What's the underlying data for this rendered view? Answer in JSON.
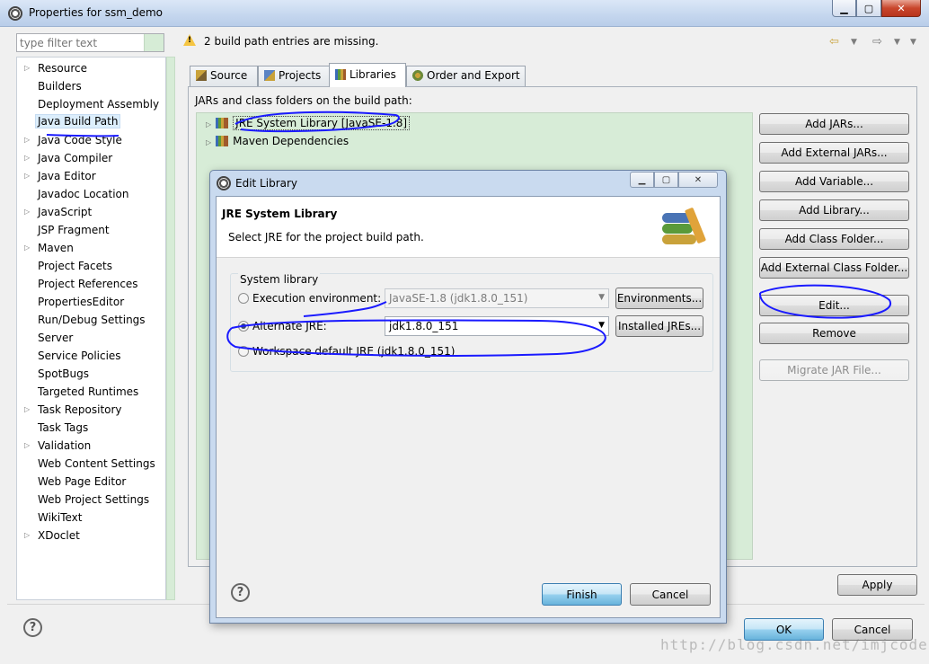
{
  "window": {
    "title": "Properties for ssm_demo",
    "controls": {
      "min": "▁",
      "max": "▢",
      "close": "✕"
    }
  },
  "filter": {
    "placeholder": "type filter text"
  },
  "nav": {
    "items": [
      {
        "label": "Resource",
        "expandable": true
      },
      {
        "label": "Builders",
        "expandable": false
      },
      {
        "label": "Deployment Assembly",
        "expandable": false
      },
      {
        "label": "Java Build Path",
        "expandable": false,
        "selected": true
      },
      {
        "label": "Java Code Style",
        "expandable": true
      },
      {
        "label": "Java Compiler",
        "expandable": true
      },
      {
        "label": "Java Editor",
        "expandable": true
      },
      {
        "label": "Javadoc Location",
        "expandable": false
      },
      {
        "label": "JavaScript",
        "expandable": true
      },
      {
        "label": "JSP Fragment",
        "expandable": false
      },
      {
        "label": "Maven",
        "expandable": true
      },
      {
        "label": "Project Facets",
        "expandable": false
      },
      {
        "label": "Project References",
        "expandable": false
      },
      {
        "label": "PropertiesEditor",
        "expandable": false
      },
      {
        "label": "Run/Debug Settings",
        "expandable": false
      },
      {
        "label": "Server",
        "expandable": false
      },
      {
        "label": "Service Policies",
        "expandable": false
      },
      {
        "label": "SpotBugs",
        "expandable": false
      },
      {
        "label": "Targeted Runtimes",
        "expandable": false
      },
      {
        "label": "Task Repository",
        "expandable": true
      },
      {
        "label": "Task Tags",
        "expandable": false
      },
      {
        "label": "Validation",
        "expandable": true
      },
      {
        "label": "Web Content Settings",
        "expandable": false
      },
      {
        "label": "Web Page Editor",
        "expandable": false
      },
      {
        "label": "Web Project Settings",
        "expandable": false
      },
      {
        "label": "WikiText",
        "expandable": false
      },
      {
        "label": "XDoclet",
        "expandable": true
      }
    ]
  },
  "header": {
    "message": "2 build path entries are missing.",
    "icons": {
      "warning": "warning-icon",
      "back": "back-arrow-icon",
      "forward": "forward-arrow-icon",
      "menu": "view-menu-icon"
    }
  },
  "tabs": [
    {
      "label": "Source",
      "icon": "source-icon"
    },
    {
      "label": "Projects",
      "icon": "projects-icon"
    },
    {
      "label": "Libraries",
      "icon": "libraries-icon",
      "active": true
    },
    {
      "label": "Order and Export",
      "icon": "order-export-icon"
    }
  ],
  "libraries": {
    "label": "JARs and class folders on the build path:",
    "entries": [
      {
        "label": "JRE System Library [JavaSE-1.8]",
        "selected": true
      },
      {
        "label": "Maven Dependencies",
        "selected": false
      }
    ],
    "buttons": {
      "add_jars": "Add JARs...",
      "add_external_jars": "Add External JARs...",
      "add_variable": "Add Variable...",
      "add_library": "Add Library...",
      "add_class_folder": "Add Class Folder...",
      "add_external_class_folder": "Add External Class Folder...",
      "edit": "Edit...",
      "remove": "Remove",
      "migrate_jar": "Migrate JAR File..."
    }
  },
  "footer": {
    "apply": "Apply",
    "ok": "OK",
    "cancel": "Cancel",
    "help": "?"
  },
  "dialog": {
    "title": "Edit Library",
    "controls": {
      "min": "▁",
      "max": "▢",
      "close": "✕"
    },
    "header_title": "JRE System Library",
    "header_desc": "Select JRE for the project build path.",
    "group_title": "System library",
    "exec_env": {
      "label": "Execution environment:",
      "value": "JavaSE-1.8 (jdk1.8.0_151)",
      "button": "Environments...",
      "checked": false
    },
    "alt_jre": {
      "label": "Alternate JRE:",
      "value": "jdk1.8.0_151",
      "button": "Installed JREs...",
      "checked": true
    },
    "workspace_default": {
      "label": "Workspace default JRE (jdk1.8.0_151)",
      "checked": false
    },
    "finish": "Finish",
    "cancel": "Cancel",
    "help": "?"
  },
  "watermark": "http://blog.csdn.net/imjcoder",
  "colors": {
    "annotation_pen": "#1a1aff",
    "tree_background": "#d7ecd7",
    "selection": "#dceefc"
  }
}
